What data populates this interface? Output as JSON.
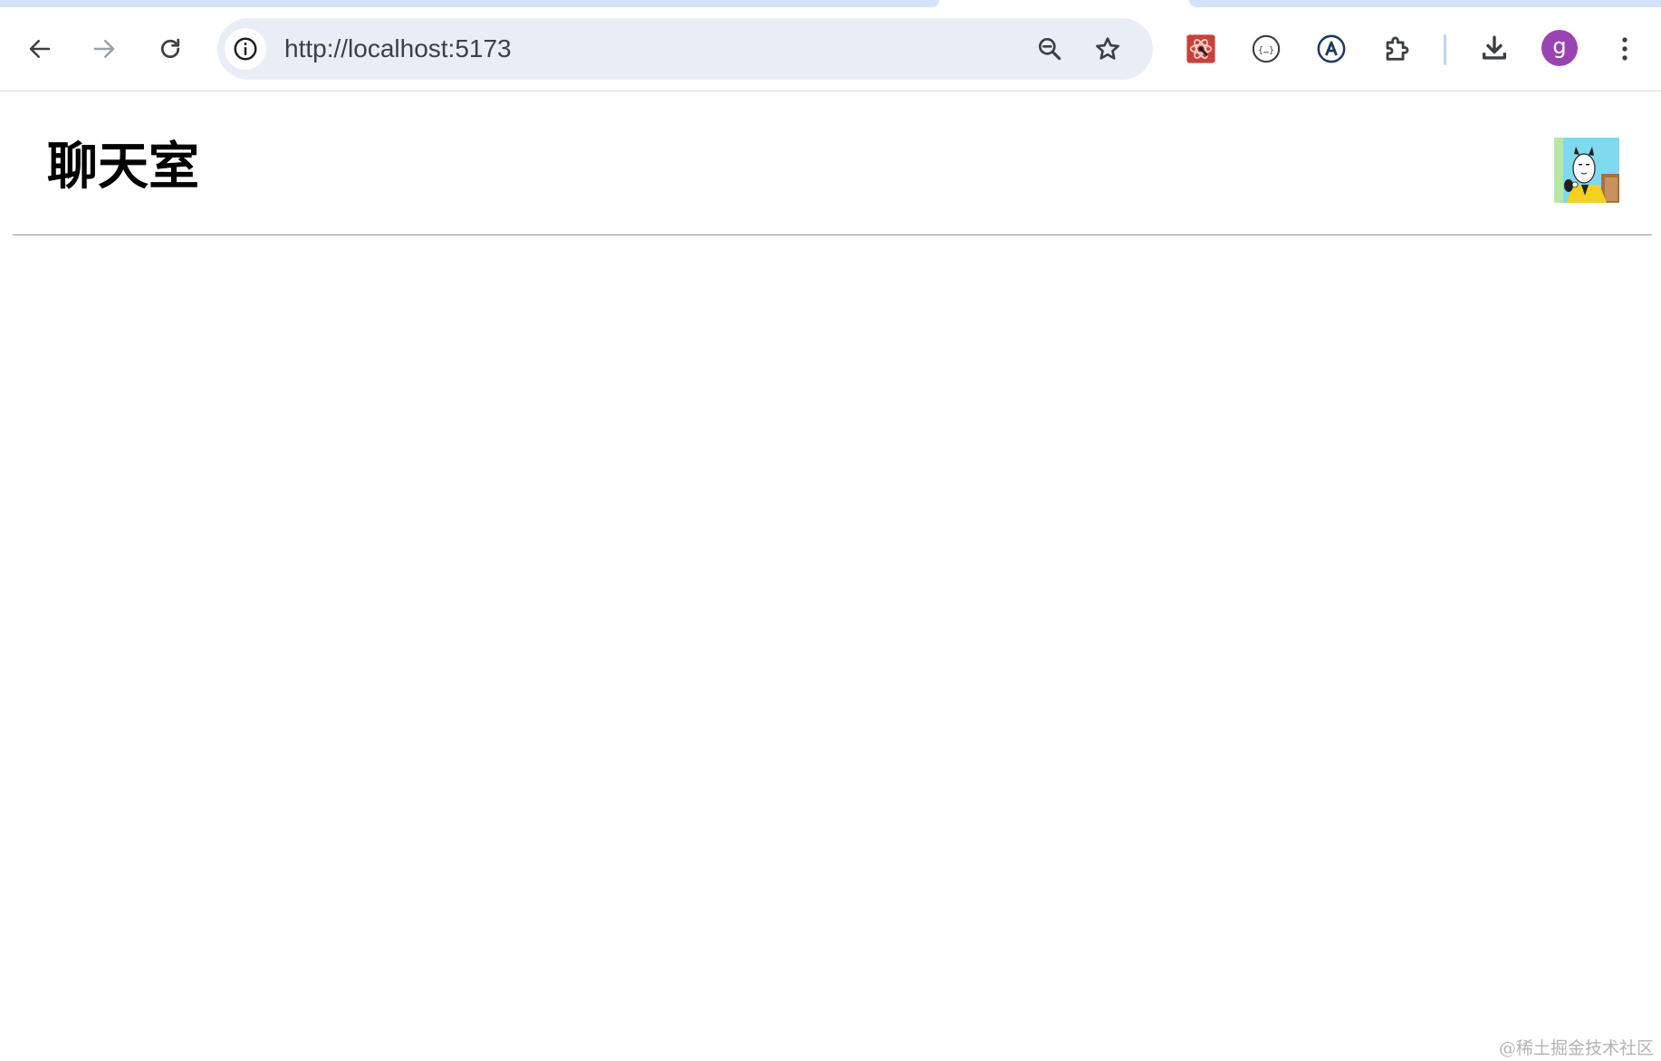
{
  "browser": {
    "url": "http://localhost:5173",
    "profile_initial": "g",
    "icons": {
      "back": "arrow-left-icon",
      "forward": "arrow-right-icon",
      "reload": "reload-icon",
      "site_info": "info-icon",
      "zoom": "zoom-out-icon",
      "bookmark": "star-icon",
      "extensions": [
        "react-devtools-icon",
        "json-formatter-icon",
        "translate-a-icon",
        "puzzle-icon"
      ],
      "download": "download-icon",
      "menu": "kebab-menu-icon"
    },
    "colors": {
      "tab_highlight": "#d3e3fd",
      "omnibox_bg": "#e9eef6",
      "profile_avatar": "#9a44b3",
      "react_ext": "#c9423a"
    }
  },
  "page": {
    "title": "聊天室",
    "avatar_icon": "user-avatar-image"
  },
  "watermark": "@稀土掘金技术社区"
}
